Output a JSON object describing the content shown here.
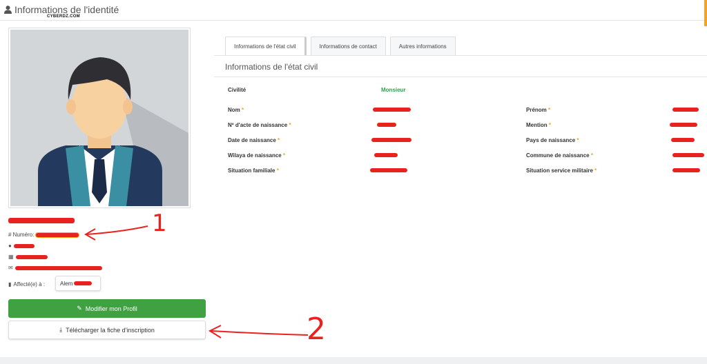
{
  "header": {
    "title": "Informations de l'identité",
    "watermark": "CYBERDZ.COM"
  },
  "profile": {
    "numero_label": "# Numéro:",
    "affecte_label": "Affecté(e) à :",
    "affecte_value": "Alem",
    "edit_button": "Modifier mon Profil",
    "download_button": "Télécharger la fiche d'inscription"
  },
  "tabs": [
    "Informations de l'état civil",
    "Informations de contact",
    "Autres informations"
  ],
  "section": {
    "title": "Informations de l'état civil",
    "civilite_label": "Civilité",
    "civilite_value": "Monsieur",
    "left_fields": [
      "Nom",
      "Nº d'acte de naissance",
      "Date de naissance",
      "Wilaya de naissance",
      "Situation familiale"
    ],
    "right_fields": [
      "Prénom",
      "Mention",
      "Pays de naissance",
      "Commune de naissance",
      "Situation service militaire"
    ],
    "required_mark": "*"
  },
  "annotations": {
    "one": "1",
    "two": "2"
  },
  "colors": {
    "green": "#3fa142",
    "required": "#f0a32a",
    "redaction": "#e8231f"
  }
}
